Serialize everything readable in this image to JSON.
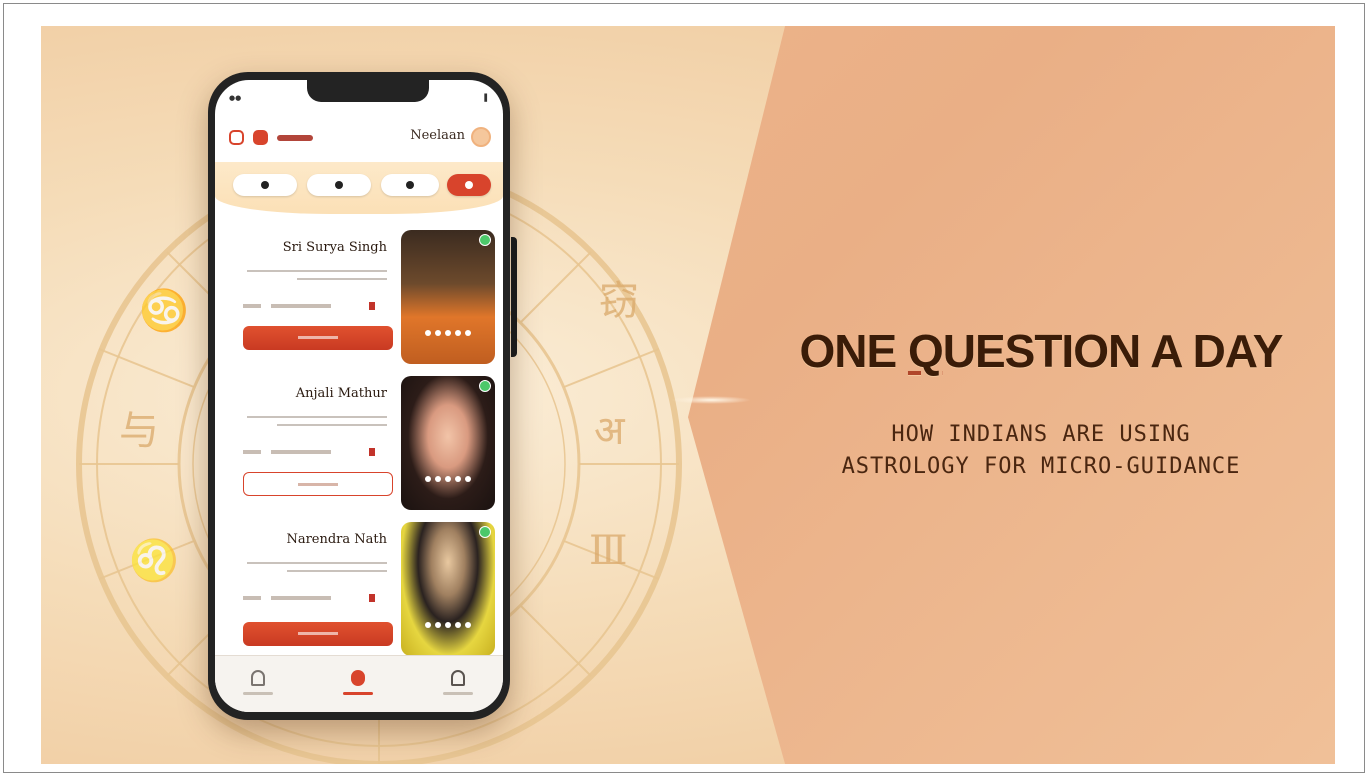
{
  "headline": {
    "pre": "ONE ",
    "emph": "Q",
    "post": "UESTION A DAY"
  },
  "subheading": {
    "line1": "HOW INDIANS ARE USING",
    "line2": "ASTROLOGY FOR MICRO-GUIDANCE"
  },
  "app": {
    "header_title": "Neelaan",
    "astrologers": [
      {
        "name": "Sri Surya Singh",
        "online": true,
        "button": "filled"
      },
      {
        "name": "Anjali Mathur",
        "online": true,
        "button": "outline"
      },
      {
        "name": "Narendra Nath",
        "online": true,
        "button": "filled"
      }
    ],
    "nav_icons": [
      "home-icon",
      "chat-icon",
      "profile-icon"
    ]
  },
  "colors": {
    "accent": "#d8442c",
    "headline": "#3a1c08",
    "right_panel": "#eaaf86",
    "background": "#f5dcb8"
  }
}
